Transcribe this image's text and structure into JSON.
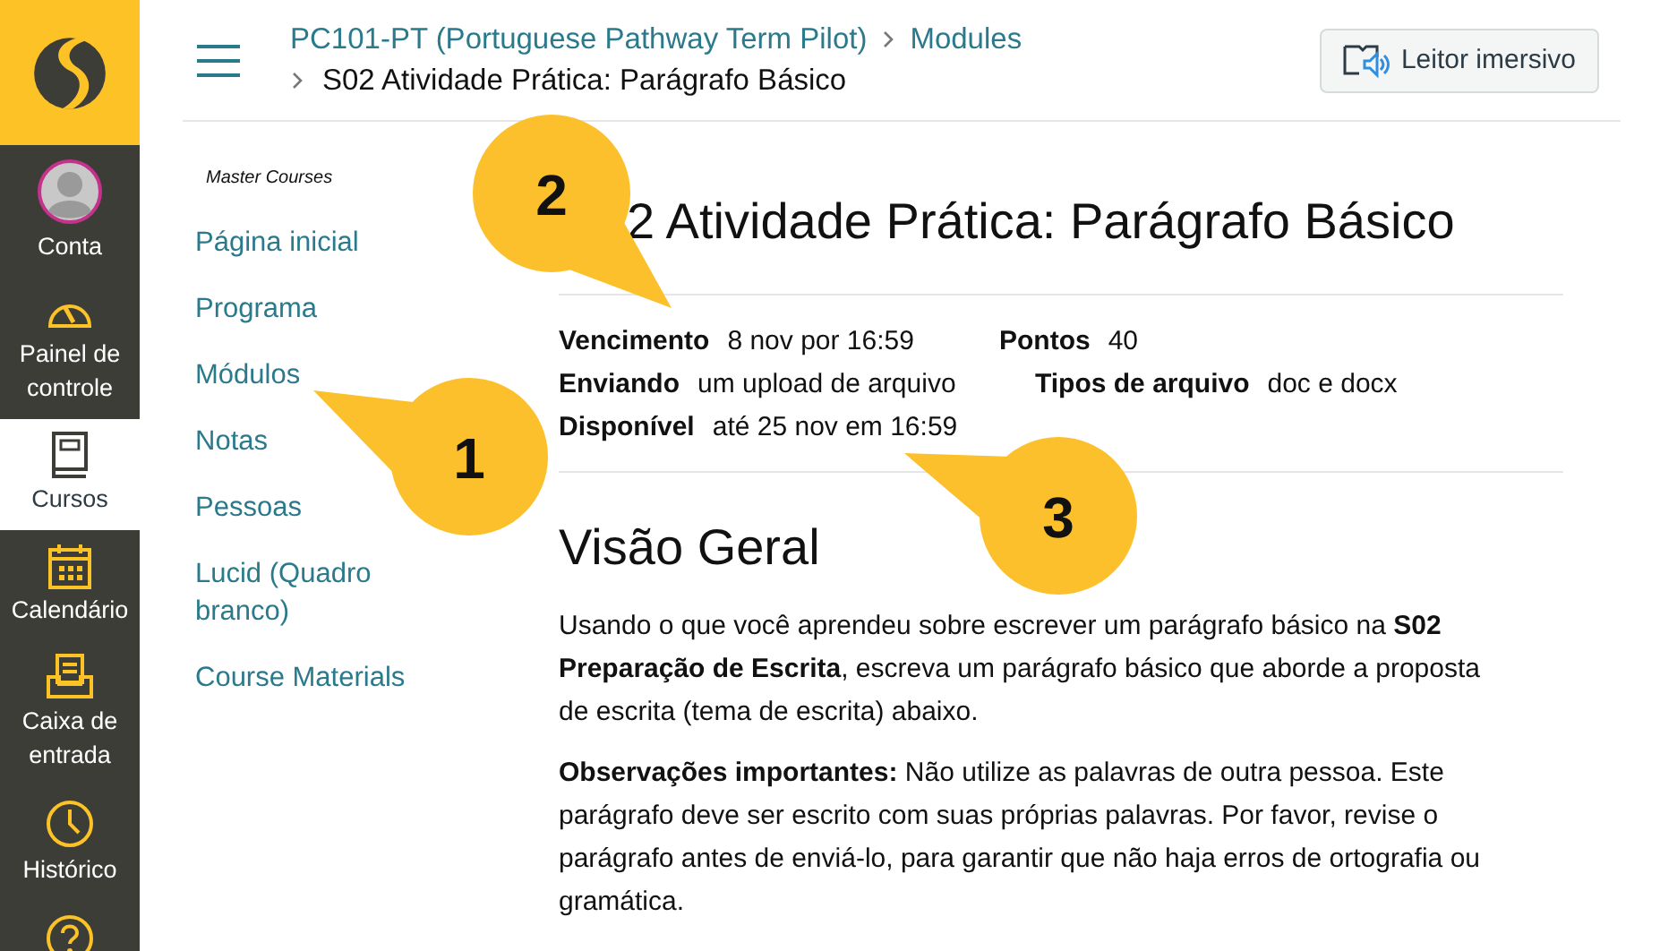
{
  "global_nav": [
    {
      "kind": "account",
      "label": "Conta",
      "selected": false
    },
    {
      "kind": "dashboard",
      "label": "Painel de controle",
      "selected": false
    },
    {
      "kind": "courses",
      "label": "Cursos",
      "selected": true
    },
    {
      "kind": "calendar",
      "label": "Calendário",
      "selected": false
    },
    {
      "kind": "inbox",
      "label": "Caixa de entrada",
      "selected": false
    },
    {
      "kind": "history",
      "label": "Histórico",
      "selected": false
    },
    {
      "kind": "help",
      "selected": false
    }
  ],
  "breadcrumb": [
    {
      "label": "PC101-PT (Portuguese Pathway Term Pilot)"
    },
    {
      "label": "Modules"
    },
    {
      "label": "S02 Atividade Prática: Parágrafo Básico"
    }
  ],
  "immersive_reader_button": "Leitor imersivo",
  "course_nav": {
    "heading": "Master Courses",
    "items": [
      {
        "label": "Página inicial"
      },
      {
        "label": "Programa"
      },
      {
        "label": "Módulos"
      },
      {
        "label": "Notas"
      },
      {
        "label": "Pessoas"
      },
      {
        "label": "Lucid (Quadro branco)"
      },
      {
        "label": "Course Materials"
      }
    ]
  },
  "title": "2 Atividade Prática: Parágrafo Básico",
  "details": [
    [
      {
        "label": "Vencimento",
        "value": "8 nov por 16:59"
      },
      {
        "label": "Pontos",
        "value": "40"
      }
    ],
    [
      {
        "label": "Enviando",
        "value": "um upload de arquivo"
      },
      {
        "label": "Tipos de arquivo",
        "value": "doc e docx"
      }
    ],
    [
      {
        "label": "Disponível",
        "value": "até 25 nov em 16:59"
      }
    ]
  ],
  "section_heading": "Visão Geral",
  "paragraphs": [
    "Usando o que você aprendeu sobre escrever um parágrafo básico na **S02 Preparação de Escrita**, escreva um parágrafo básico que aborde a proposta de escrita (tema de escrita) abaixo.",
    "**Observações importantes:** Não utilize as palavras de outra pessoa. Este parágrafo deve ser escrito com suas próprias palavras. Por favor, revise o parágrafo antes de enviá-lo, para garantir que não haja erros de ortografia ou gramática."
  ],
  "callouts": [
    "2",
    "1",
    "3"
  ]
}
